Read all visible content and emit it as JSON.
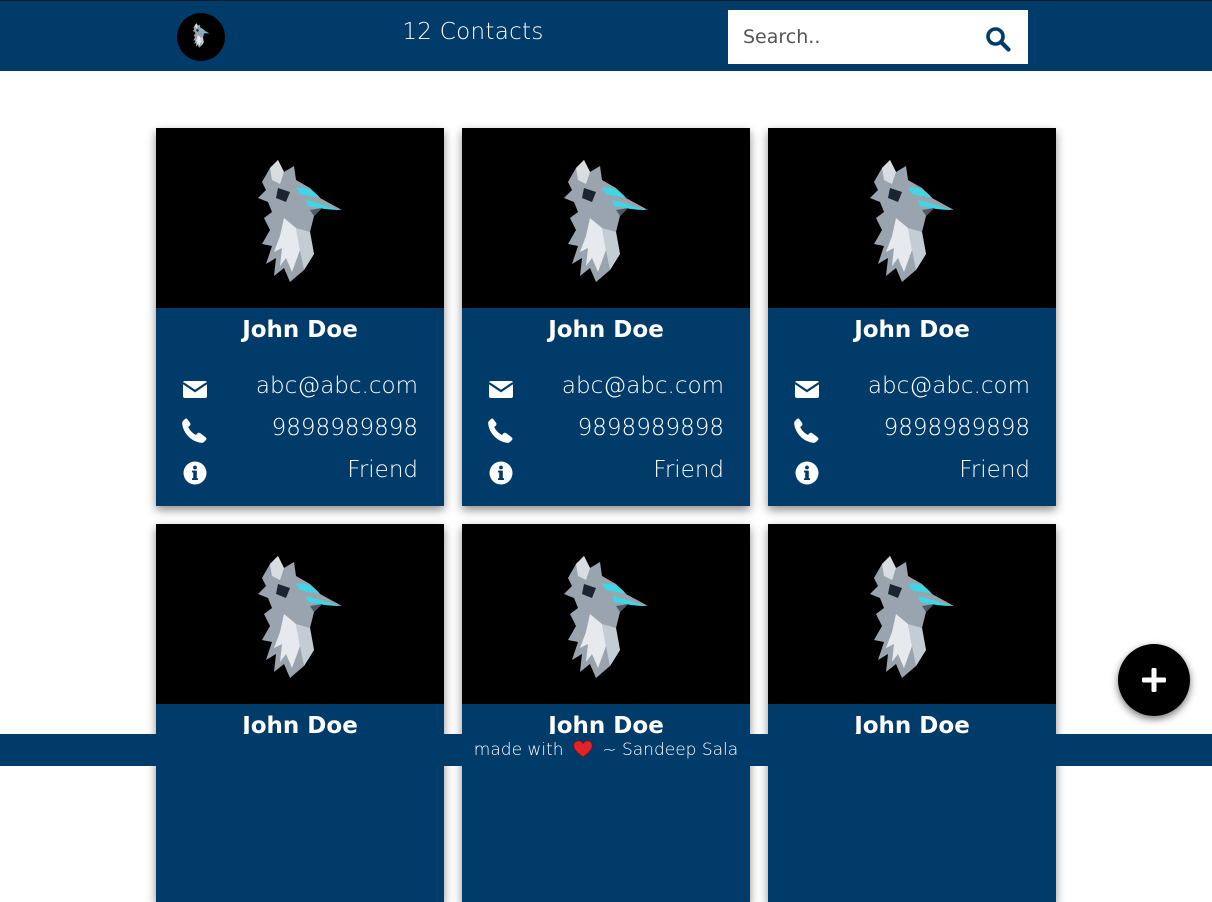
{
  "header": {
    "contact_count": "12 Contacts",
    "search_placeholder": "Search..",
    "search_value": ""
  },
  "contacts": [
    {
      "name": "John Doe",
      "email": "abc@abc.com",
      "phone": "9898989898",
      "type": "Friend"
    },
    {
      "name": "John Doe",
      "email": "abc@abc.com",
      "phone": "9898989898",
      "type": "Friend"
    },
    {
      "name": "John Doe",
      "email": "abc@abc.com",
      "phone": "9898989898",
      "type": "Friend"
    },
    {
      "name": "John Doe",
      "email": "",
      "phone": "",
      "type": ""
    },
    {
      "name": "John Doe",
      "email": "",
      "phone": "",
      "type": ""
    },
    {
      "name": "John Doe",
      "email": "",
      "phone": "",
      "type": ""
    }
  ],
  "footer": {
    "prefix": "made with",
    "suffix": "~ Sandeep Sala"
  },
  "icons": {
    "logo": "wolf-logo-icon",
    "search": "search-icon",
    "email": "envelope-icon",
    "phone": "phone-icon",
    "type": "info-icon",
    "add": "plus-icon",
    "heart": "heart-icon"
  },
  "colors": {
    "primary": "#003b6a",
    "card_image_bg": "#000000",
    "text": "#ffffff",
    "heart": "#e0242a",
    "wolf_accent": "#3fd6e6"
  }
}
